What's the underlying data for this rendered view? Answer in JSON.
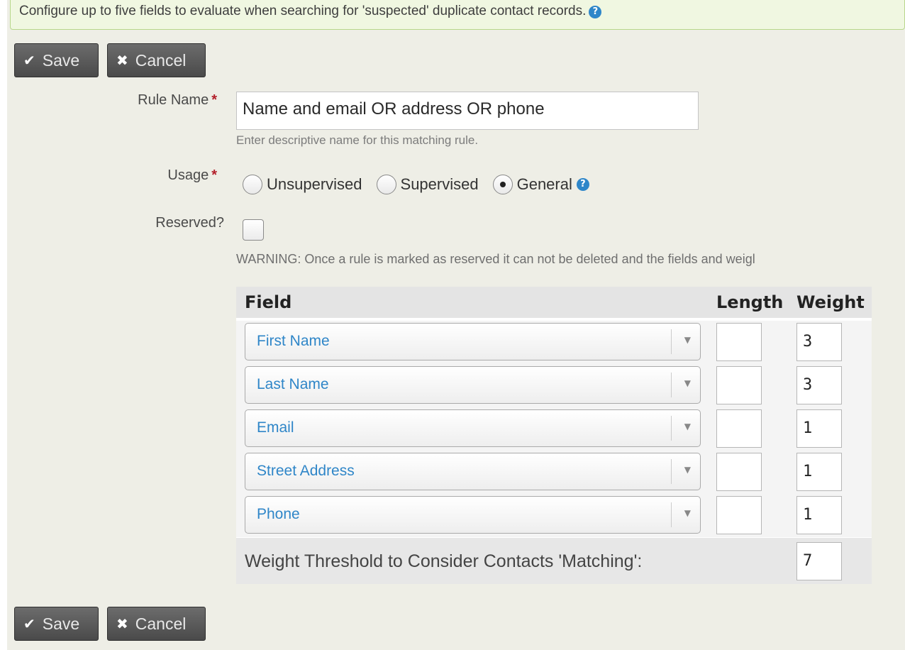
{
  "help": {
    "text": "Configure up to five fields to evaluate when searching for 'suspected' duplicate contact records.",
    "icon": "question-circle-icon"
  },
  "buttons": {
    "save_label": "Save",
    "cancel_label": "Cancel",
    "save_icon": "✔",
    "cancel_icon": "✖"
  },
  "form": {
    "rule_name_label": "Rule Name",
    "required_mark": "*",
    "rule_name_value": "Name and email OR address OR phone",
    "rule_name_description": "Enter descriptive name for this matching rule.",
    "usage_label": "Usage",
    "usage_options": [
      {
        "label": "Unsupervised",
        "checked": false
      },
      {
        "label": "Supervised",
        "checked": false
      },
      {
        "label": "General",
        "checked": true
      }
    ],
    "reserved_label": "Reserved?",
    "reserved_checked": false,
    "warning": "WARNING: Once a rule is marked as reserved it can not be deleted and the fields and weigl"
  },
  "grid": {
    "headers": {
      "field": "Field",
      "length": "Length",
      "weight": "Weight"
    },
    "rows": [
      {
        "field": "First Name",
        "length": "",
        "weight": "3"
      },
      {
        "field": "Last Name",
        "length": "",
        "weight": "3"
      },
      {
        "field": "Email",
        "length": "",
        "weight": "1"
      },
      {
        "field": "Street Address",
        "length": "",
        "weight": "1"
      },
      {
        "field": "Phone",
        "length": "",
        "weight": "1"
      }
    ],
    "threshold_label": "Weight Threshold to Consider Contacts 'Matching':",
    "threshold_value": "7",
    "dropdown_arrow": "▼"
  },
  "colors": {
    "accent_link": "#2f86c8",
    "required": "#b3202b",
    "button_bg": "#555555",
    "help_border": "#b8d78b"
  }
}
